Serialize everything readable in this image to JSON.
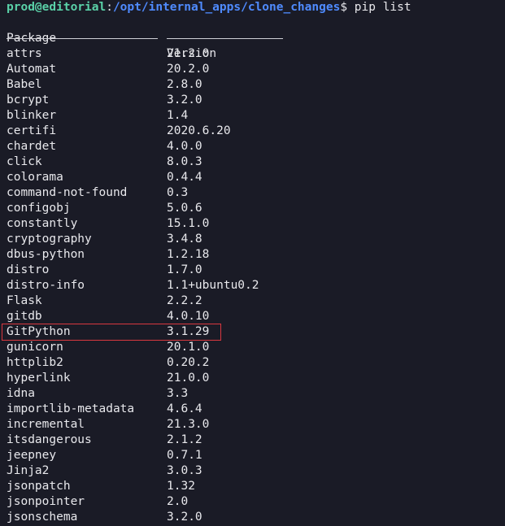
{
  "prompt": {
    "user_host": "prod@editorial",
    "separator": ":",
    "path": "/opt/internal_apps/clone_changes",
    "symbol": "$",
    "command": " pip list"
  },
  "headers": {
    "package": "Package",
    "version": "Version"
  },
  "packages": [
    {
      "name": "attrs",
      "version": "21.2.0"
    },
    {
      "name": "Automat",
      "version": "20.2.0"
    },
    {
      "name": "Babel",
      "version": "2.8.0"
    },
    {
      "name": "bcrypt",
      "version": "3.2.0"
    },
    {
      "name": "blinker",
      "version": "1.4"
    },
    {
      "name": "certifi",
      "version": "2020.6.20"
    },
    {
      "name": "chardet",
      "version": "4.0.0"
    },
    {
      "name": "click",
      "version": "8.0.3"
    },
    {
      "name": "colorama",
      "version": "0.4.4"
    },
    {
      "name": "command-not-found",
      "version": "0.3"
    },
    {
      "name": "configobj",
      "version": "5.0.6"
    },
    {
      "name": "constantly",
      "version": "15.1.0"
    },
    {
      "name": "cryptography",
      "version": "3.4.8"
    },
    {
      "name": "dbus-python",
      "version": "1.2.18"
    },
    {
      "name": "distro",
      "version": "1.7.0"
    },
    {
      "name": "distro-info",
      "version": "1.1+ubuntu0.2"
    },
    {
      "name": "Flask",
      "version": "2.2.2"
    },
    {
      "name": "gitdb",
      "version": "4.0.10"
    },
    {
      "name": "GitPython",
      "version": "3.1.29"
    },
    {
      "name": "gunicorn",
      "version": "20.1.0"
    },
    {
      "name": "httplib2",
      "version": "0.20.2"
    },
    {
      "name": "hyperlink",
      "version": "21.0.0"
    },
    {
      "name": "idna",
      "version": "3.3"
    },
    {
      "name": "importlib-metadata",
      "version": "4.6.4"
    },
    {
      "name": "incremental",
      "version": "21.3.0"
    },
    {
      "name": "itsdangerous",
      "version": "2.1.2"
    },
    {
      "name": "jeepney",
      "version": "0.7.1"
    },
    {
      "name": "Jinja2",
      "version": "3.0.3"
    },
    {
      "name": "jsonpatch",
      "version": "1.32"
    },
    {
      "name": "jsonpointer",
      "version": "2.0"
    },
    {
      "name": "jsonschema",
      "version": "3.2.0"
    }
  ],
  "highlighted_package": "GitPython",
  "colors": {
    "background": "#1a1b26",
    "prompt_user": "#5ad1a8",
    "prompt_path": "#4f8bff",
    "highlight_border": "#d9383f"
  }
}
